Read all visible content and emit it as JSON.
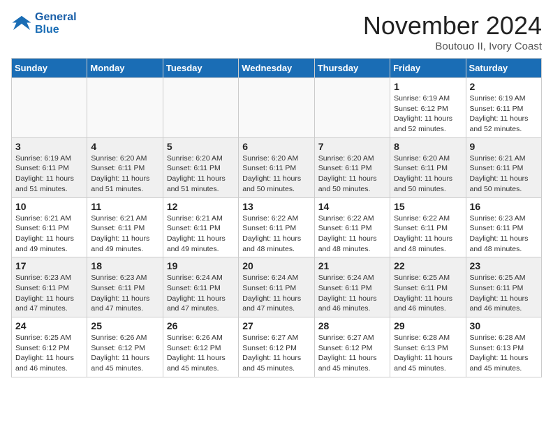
{
  "logo": {
    "line1": "General",
    "line2": "Blue"
  },
  "header": {
    "month": "November 2024",
    "location": "Boutouo II, Ivory Coast"
  },
  "weekdays": [
    "Sunday",
    "Monday",
    "Tuesday",
    "Wednesday",
    "Thursday",
    "Friday",
    "Saturday"
  ],
  "weeks": [
    [
      {
        "day": "",
        "info": ""
      },
      {
        "day": "",
        "info": ""
      },
      {
        "day": "",
        "info": ""
      },
      {
        "day": "",
        "info": ""
      },
      {
        "day": "",
        "info": ""
      },
      {
        "day": "1",
        "info": "Sunrise: 6:19 AM\nSunset: 6:12 PM\nDaylight: 11 hours\nand 52 minutes."
      },
      {
        "day": "2",
        "info": "Sunrise: 6:19 AM\nSunset: 6:11 PM\nDaylight: 11 hours\nand 52 minutes."
      }
    ],
    [
      {
        "day": "3",
        "info": "Sunrise: 6:19 AM\nSunset: 6:11 PM\nDaylight: 11 hours\nand 51 minutes."
      },
      {
        "day": "4",
        "info": "Sunrise: 6:20 AM\nSunset: 6:11 PM\nDaylight: 11 hours\nand 51 minutes."
      },
      {
        "day": "5",
        "info": "Sunrise: 6:20 AM\nSunset: 6:11 PM\nDaylight: 11 hours\nand 51 minutes."
      },
      {
        "day": "6",
        "info": "Sunrise: 6:20 AM\nSunset: 6:11 PM\nDaylight: 11 hours\nand 50 minutes."
      },
      {
        "day": "7",
        "info": "Sunrise: 6:20 AM\nSunset: 6:11 PM\nDaylight: 11 hours\nand 50 minutes."
      },
      {
        "day": "8",
        "info": "Sunrise: 6:20 AM\nSunset: 6:11 PM\nDaylight: 11 hours\nand 50 minutes."
      },
      {
        "day": "9",
        "info": "Sunrise: 6:21 AM\nSunset: 6:11 PM\nDaylight: 11 hours\nand 50 minutes."
      }
    ],
    [
      {
        "day": "10",
        "info": "Sunrise: 6:21 AM\nSunset: 6:11 PM\nDaylight: 11 hours\nand 49 minutes."
      },
      {
        "day": "11",
        "info": "Sunrise: 6:21 AM\nSunset: 6:11 PM\nDaylight: 11 hours\nand 49 minutes."
      },
      {
        "day": "12",
        "info": "Sunrise: 6:21 AM\nSunset: 6:11 PM\nDaylight: 11 hours\nand 49 minutes."
      },
      {
        "day": "13",
        "info": "Sunrise: 6:22 AM\nSunset: 6:11 PM\nDaylight: 11 hours\nand 48 minutes."
      },
      {
        "day": "14",
        "info": "Sunrise: 6:22 AM\nSunset: 6:11 PM\nDaylight: 11 hours\nand 48 minutes."
      },
      {
        "day": "15",
        "info": "Sunrise: 6:22 AM\nSunset: 6:11 PM\nDaylight: 11 hours\nand 48 minutes."
      },
      {
        "day": "16",
        "info": "Sunrise: 6:23 AM\nSunset: 6:11 PM\nDaylight: 11 hours\nand 48 minutes."
      }
    ],
    [
      {
        "day": "17",
        "info": "Sunrise: 6:23 AM\nSunset: 6:11 PM\nDaylight: 11 hours\nand 47 minutes."
      },
      {
        "day": "18",
        "info": "Sunrise: 6:23 AM\nSunset: 6:11 PM\nDaylight: 11 hours\nand 47 minutes."
      },
      {
        "day": "19",
        "info": "Sunrise: 6:24 AM\nSunset: 6:11 PM\nDaylight: 11 hours\nand 47 minutes."
      },
      {
        "day": "20",
        "info": "Sunrise: 6:24 AM\nSunset: 6:11 PM\nDaylight: 11 hours\nand 47 minutes."
      },
      {
        "day": "21",
        "info": "Sunrise: 6:24 AM\nSunset: 6:11 PM\nDaylight: 11 hours\nand 46 minutes."
      },
      {
        "day": "22",
        "info": "Sunrise: 6:25 AM\nSunset: 6:11 PM\nDaylight: 11 hours\nand 46 minutes."
      },
      {
        "day": "23",
        "info": "Sunrise: 6:25 AM\nSunset: 6:11 PM\nDaylight: 11 hours\nand 46 minutes."
      }
    ],
    [
      {
        "day": "24",
        "info": "Sunrise: 6:25 AM\nSunset: 6:12 PM\nDaylight: 11 hours\nand 46 minutes."
      },
      {
        "day": "25",
        "info": "Sunrise: 6:26 AM\nSunset: 6:12 PM\nDaylight: 11 hours\nand 45 minutes."
      },
      {
        "day": "26",
        "info": "Sunrise: 6:26 AM\nSunset: 6:12 PM\nDaylight: 11 hours\nand 45 minutes."
      },
      {
        "day": "27",
        "info": "Sunrise: 6:27 AM\nSunset: 6:12 PM\nDaylight: 11 hours\nand 45 minutes."
      },
      {
        "day": "28",
        "info": "Sunrise: 6:27 AM\nSunset: 6:12 PM\nDaylight: 11 hours\nand 45 minutes."
      },
      {
        "day": "29",
        "info": "Sunrise: 6:28 AM\nSunset: 6:13 PM\nDaylight: 11 hours\nand 45 minutes."
      },
      {
        "day": "30",
        "info": "Sunrise: 6:28 AM\nSunset: 6:13 PM\nDaylight: 11 hours\nand 45 minutes."
      }
    ]
  ]
}
